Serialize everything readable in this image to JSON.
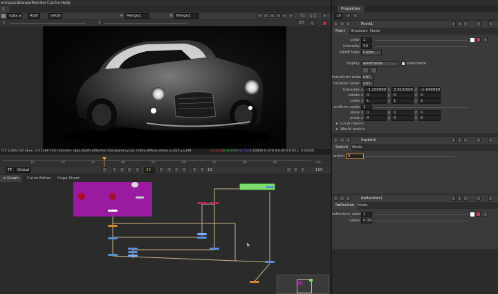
{
  "menu": [
    "orkspace",
    "Viewer",
    "Render",
    "Cache",
    "Help"
  ],
  "viewer_tab": "1",
  "viewer_toolbar": {
    "channels": "rgba.alpha",
    "colorspace": "RGB",
    "lut": "sRGB",
    "input_a": "Merge2",
    "input_b": "Merge2",
    "zoom": "71",
    "ratio": "1:1",
    "mode": "2D",
    "frame_a": "1",
    "frame_b": "1"
  },
  "viewer_info": {
    "left": "720 1280x720  bbox: 0 0 1280 720 channels: rgba,depth,reflection,transparency,car_matte,diffuse_emou  x=625 y=294",
    "r": "0.02432",
    "g": "0.02429",
    "b": "0.01734",
    "a": "1.00000",
    "right": "H:276 S:0.00 V:0.02  L: 0.02430"
  },
  "timeline": {
    "ticks": [
      "10",
      "20",
      "30",
      "40",
      "50",
      "60",
      "70",
      "80",
      "90"
    ],
    "end": "100",
    "fps": "TF",
    "scope": "Global",
    "current_frame": "34",
    "step": "10",
    "last_frame": "100"
  },
  "bottom_tabs": [
    "e Graph",
    "Curve Editor",
    "Dope Sheet"
  ],
  "properties": {
    "tab": "Properties",
    "counter": "10",
    "point1": {
      "title": "Point1",
      "tabs": [
        "Point",
        "Shadows",
        "Node"
      ],
      "color_label": "color",
      "color_value": "1",
      "intensity_label": "intensity",
      "intensity_value": "50",
      "falloff_label": "falloff type",
      "falloff_value": "Cubic",
      "display_label": "display",
      "display_value": "wireframe",
      "selectable_label": "selectable",
      "transform_order_label": "transform order",
      "transform_order_value": "SRT",
      "rotation_order_label": "rotation order",
      "rotation_order_value": "ZXY",
      "translate_label": "translate",
      "translate": [
        "-3.25999999",
        "3.91500009",
        "-1.64999996"
      ],
      "rotate_label": "rotate",
      "rotate": [
        "0",
        "0",
        "0"
      ],
      "scale_label": "scale",
      "scale": [
        "1",
        "1",
        "1"
      ],
      "uniform_scale_label": "uniform scale",
      "uniform_scale_value": "1",
      "skew_label": "skew",
      "skew": [
        "0",
        "0",
        "0"
      ],
      "pivot_label": "pivot",
      "pivot": [
        "0",
        "0",
        "0"
      ],
      "local_matrix": "Local matrix",
      "world_matrix": "World matrix"
    },
    "switch1": {
      "title": "Switch1",
      "tabs": [
        "Switch",
        "Node"
      ],
      "which_label": "which",
      "which_value": "0"
    },
    "reflection1": {
      "title": "Reflection1",
      "tabs": [
        "Reflection",
        "Node"
      ],
      "color_label": "reflection_color",
      "color_value": "1",
      "value_label": "value",
      "value_value": "0.39"
    }
  },
  "colors": {
    "backdrop": "#9a1aa0",
    "selected_node": "#7fdc6e",
    "scanline_node": "#5a8fd8",
    "merge_node": "#b22c5a",
    "orange_node": "#d9862a"
  }
}
